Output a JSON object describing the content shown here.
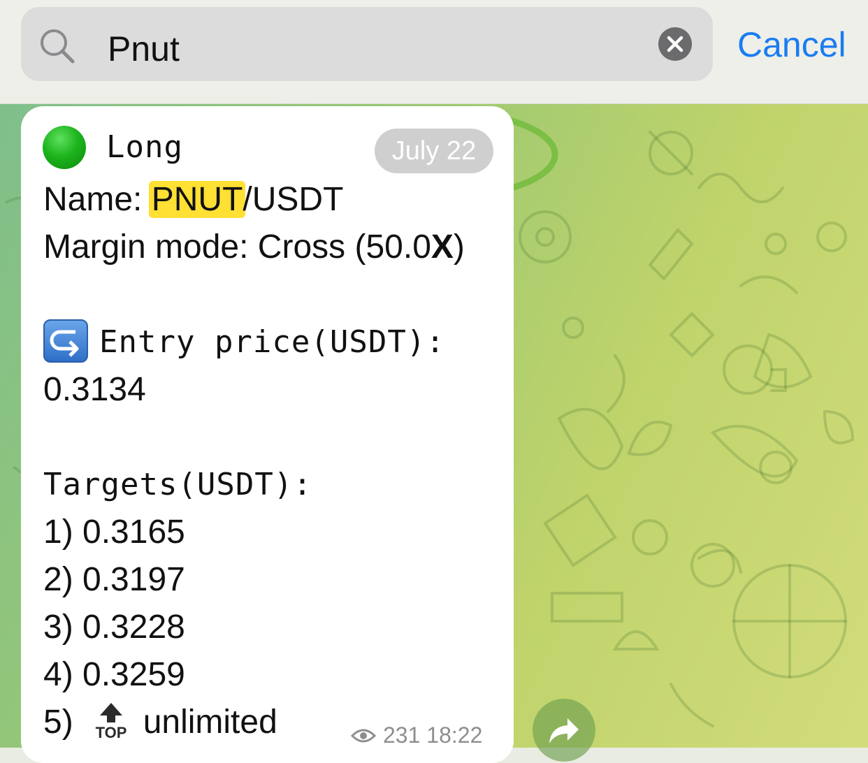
{
  "search": {
    "query": "Pnut",
    "cancel_label": "Cancel"
  },
  "message": {
    "side_label": "Long",
    "date": "July 22",
    "name_label": "Name: ",
    "name_highlight": "PNUT",
    "name_rest": "/USDT",
    "margin_label": "Margin mode: Cross (50.0",
    "margin_x": "X",
    "margin_close": ")",
    "entry_label": "Entry price(USDT):",
    "entry_value": "0.3134",
    "targets_label": "Targets(USDT):",
    "targets": [
      "1) 0.3165",
      "2) 0.3197",
      "3) 0.3228",
      "4) 0.3259"
    ],
    "target5_prefix": "5)",
    "target5_top_icon_text": "TOP",
    "target5_value": "unlimited",
    "views": "231",
    "time": "18:22"
  },
  "colors": {
    "accent": "#1a7cf2",
    "highlight": "#ffe033",
    "annotation": "#7bbf45",
    "long_dot": "#1db51d"
  },
  "icons": [
    "search-icon",
    "clear-icon",
    "green-circle-icon",
    "entry-arrow-icon",
    "top-arrow-icon",
    "eye-icon",
    "forward-icon"
  ]
}
